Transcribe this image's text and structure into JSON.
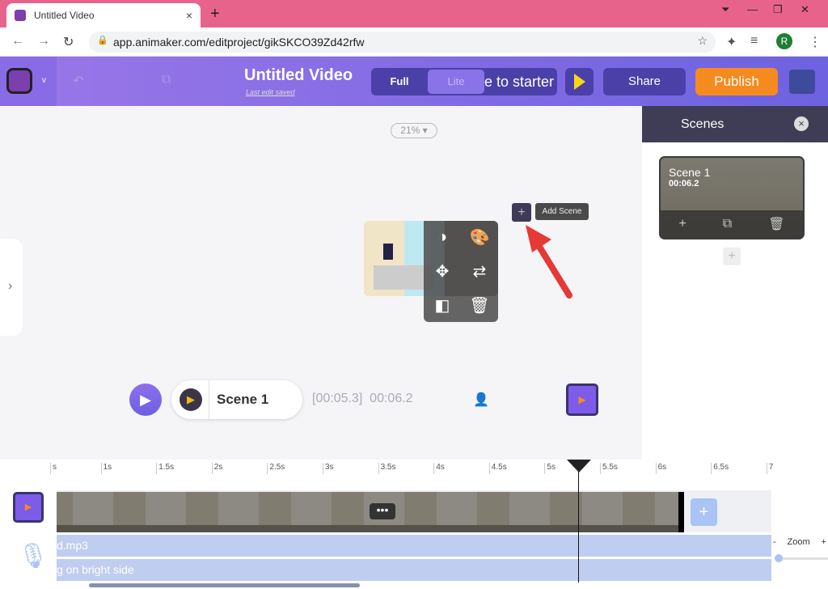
{
  "browser": {
    "tab_title": "Untitled Video",
    "url": "app.animaker.com/editproject/gikSKCO39Zd42rfw",
    "profile_initial": "R"
  },
  "header": {
    "title": "Untitled Video",
    "last_saved": "Last edit saved",
    "mode_full": "Full",
    "mode_lite": "Lite",
    "switch_label": "e to starter",
    "share": "Share",
    "publish": "Publish"
  },
  "canvas": {
    "zoom": "21%",
    "add_scene_tooltip": "Add Scene"
  },
  "player": {
    "scene_name": "Scene 1",
    "current_time": "[00:05.3]",
    "total_time": "00:06.2"
  },
  "scenes_panel": {
    "title": "Scenes",
    "scenes": [
      {
        "name": "Scene 1",
        "duration": "00:06.2"
      }
    ]
  },
  "timeline": {
    "ticks": [
      "s",
      "1s",
      "1.5s",
      "2s",
      "2.5s",
      "3s",
      "3.5s",
      "4s",
      "4.5s",
      "5s",
      "5.5s",
      "6s",
      "6.5s",
      "7"
    ],
    "audio_tracks": [
      "d.mp3",
      "g on bright side"
    ],
    "zoom_label": "Zoom",
    "zoom_minus": "-",
    "zoom_plus": "+",
    "playhead_seconds": 5.3
  },
  "colors": {
    "accent": "#7c5ce8",
    "publish": "#f58b1f",
    "dark": "#3f3d56"
  }
}
